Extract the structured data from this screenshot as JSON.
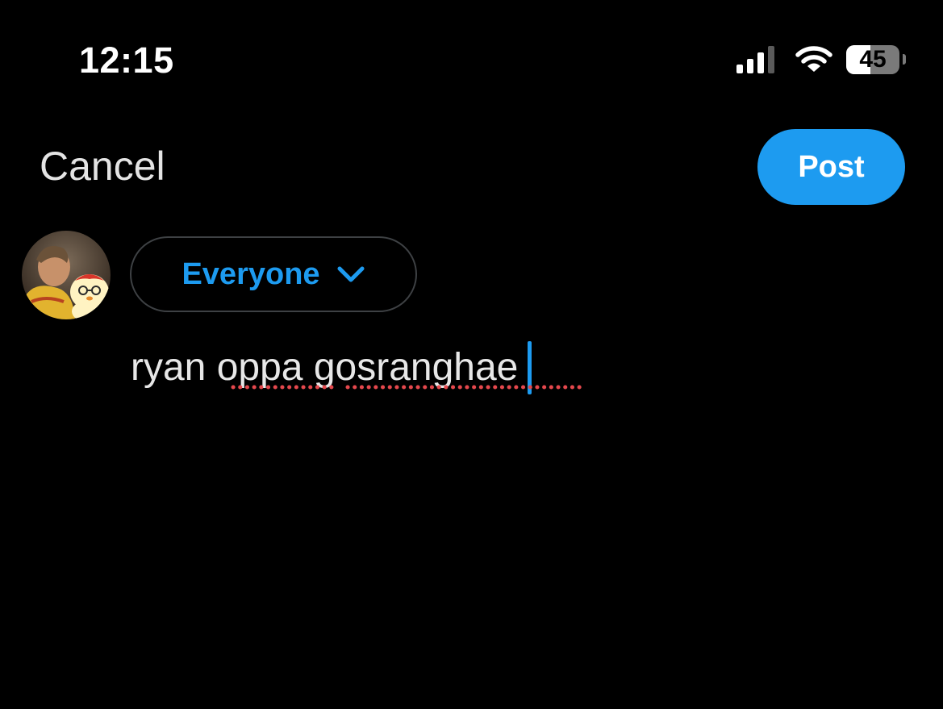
{
  "status_bar": {
    "time": "12:15",
    "battery_percent": "45",
    "battery_level": 0.45,
    "icons": [
      "signal-icon",
      "wifi-icon",
      "battery-icon"
    ]
  },
  "header": {
    "cancel_label": "Cancel",
    "post_label": "Post"
  },
  "composer": {
    "audience_label": "Everyone",
    "text": "ryan oppa gosranghae",
    "misspelled_words": [
      "oppa",
      "gosranghae"
    ]
  },
  "colors": {
    "background": "#000000",
    "accent": "#1d9bf0",
    "text": "#e7e7e7",
    "spellcheck": "#e5484d",
    "pill_border": "#3e4144"
  }
}
